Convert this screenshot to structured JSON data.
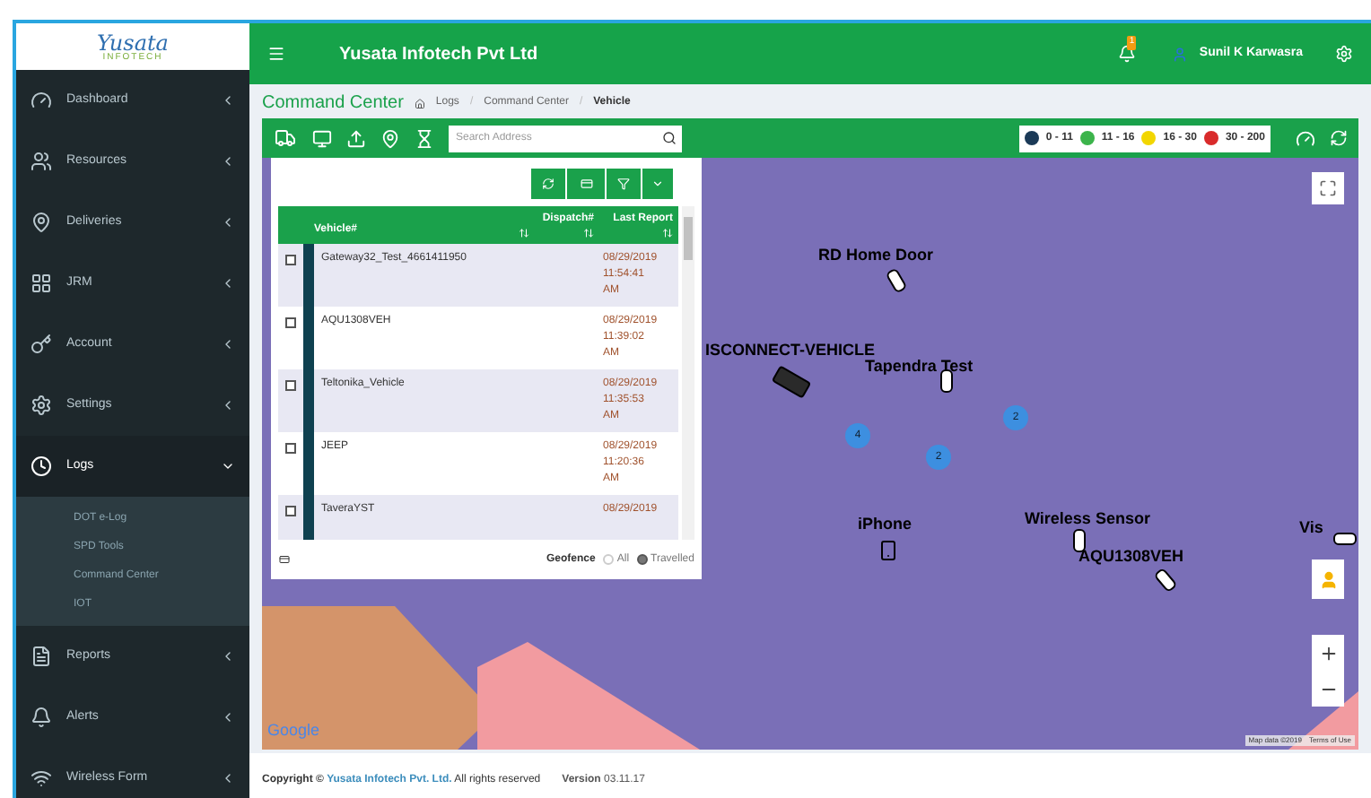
{
  "logo": {
    "name": "Yusata",
    "tagline": "INFOTECH"
  },
  "header": {
    "title": "Yusata Infotech Pvt Ltd",
    "notification_count": "1",
    "user": "Sunil K Karwasra"
  },
  "sidebar": {
    "items": [
      {
        "label": "Dashboard",
        "selected": false,
        "expanded": false
      },
      {
        "label": "Resources",
        "selected": false,
        "expanded": false
      },
      {
        "label": "Deliveries",
        "selected": false,
        "expanded": false
      },
      {
        "label": "JRM",
        "selected": false,
        "expanded": false
      },
      {
        "label": "Account",
        "selected": false,
        "expanded": false
      },
      {
        "label": "Settings",
        "selected": false,
        "expanded": false
      },
      {
        "label": "Logs",
        "selected": true,
        "expanded": true,
        "children": [
          {
            "label": "DOT e-Log"
          },
          {
            "label": "SPD Tools"
          },
          {
            "label": "Command Center"
          },
          {
            "label": "IOT"
          }
        ]
      },
      {
        "label": "Reports",
        "selected": false,
        "expanded": false
      },
      {
        "label": "Alerts",
        "selected": false,
        "expanded": false
      },
      {
        "label": "Wireless Form",
        "selected": false,
        "expanded": false
      }
    ]
  },
  "breadcrumb": {
    "title": "Command Center",
    "path": [
      "Logs",
      "Command Center",
      "Vehicle"
    ],
    "separator": "/"
  },
  "toolbar": {
    "search": {
      "placeholder": "Search Address"
    },
    "legend": [
      {
        "label": "0 - 11",
        "color": "#1b3a57"
      },
      {
        "label": "11 - 16",
        "color": "#3cb44b"
      },
      {
        "label": "16 - 30",
        "color": "#f2d600"
      },
      {
        "label": "30 - 200",
        "color": "#d92b2b"
      }
    ]
  },
  "vehicle_table": {
    "columns": [
      "Vehicle#",
      "Dispatch#",
      "Last Report"
    ],
    "rows": [
      {
        "vehicle": "Gateway32_Test_4661411950",
        "last_report": [
          "08/29/2019",
          "11:54:41",
          "AM"
        ],
        "checked": false,
        "color": "#0f4150"
      },
      {
        "vehicle": "AQU1308VEH",
        "last_report": [
          "08/29/2019",
          "11:39:02",
          "AM"
        ],
        "checked": false,
        "color": "#0f4150"
      },
      {
        "vehicle": "Teltonika_Vehicle",
        "last_report": [
          "08/29/2019",
          "11:35:53",
          "AM"
        ],
        "checked": false,
        "color": "#0f4150"
      },
      {
        "vehicle": "JEEP",
        "last_report": [
          "08/29/2019",
          "11:20:36",
          "AM"
        ],
        "checked": false,
        "color": "#0f4150"
      },
      {
        "vehicle": "TaveraYST",
        "last_report": [
          "08/29/2019"
        ],
        "checked": false,
        "color": "#0f4150"
      }
    ],
    "geofence": {
      "label": "Geofence",
      "options": [
        {
          "label": "All",
          "selected": false
        },
        {
          "label": "Travelled",
          "selected": true
        }
      ]
    }
  },
  "map": {
    "markers": [
      {
        "label": "RD Home Door",
        "kind": "car"
      },
      {
        "label": "ISCONNECT-VEHICLE",
        "kind": "truck"
      },
      {
        "label": "Tapendra Test",
        "kind": "car"
      },
      {
        "label": "iPhone",
        "kind": "phone"
      },
      {
        "label": "Wireless Sensor",
        "kind": "car"
      },
      {
        "label": "AQU1308VEH",
        "kind": "car"
      },
      {
        "label": "Vis",
        "kind": "car"
      }
    ],
    "clusters": [
      "4",
      "2",
      "2"
    ],
    "logo": "Google",
    "attribution": [
      "Map data ©2019",
      "Terms of Use"
    ]
  },
  "footer": {
    "copyright": "Copyright ©",
    "company": "Yusata Infotech Pvt. Ltd.",
    "rights": "All rights reserved",
    "version_label": "Version",
    "version": "03.11.17"
  }
}
